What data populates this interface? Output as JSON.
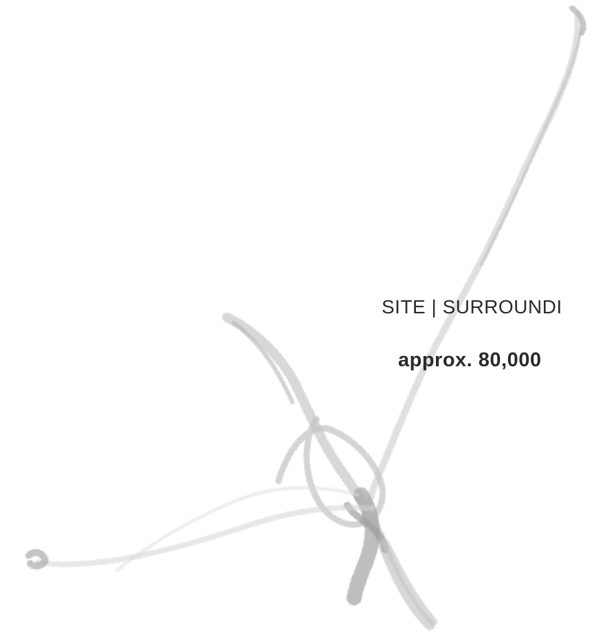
{
  "slide": {
    "heading": "SITE | SURROUNDI",
    "area_text": "approx. 80,000",
    "background_color": "#ffffff",
    "text_color": "#2a2a2a",
    "brush_color": "#c8c8c8",
    "decoration_icon": "calligraphy-brush-stroke"
  }
}
